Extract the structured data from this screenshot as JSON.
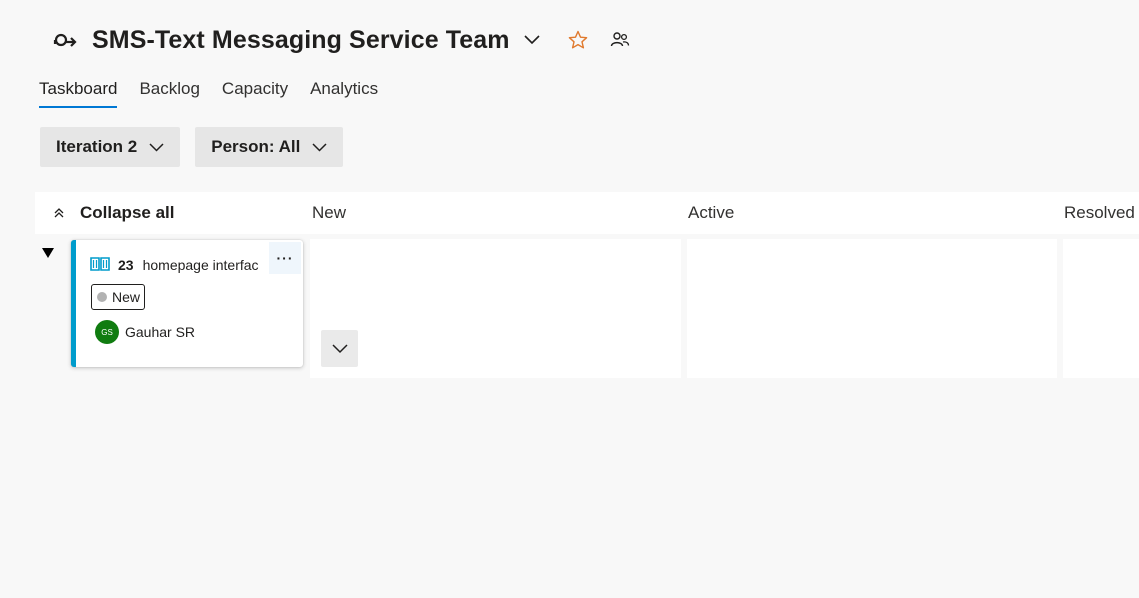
{
  "header": {
    "team_icon": "team-rotate-icon",
    "title": "SMS-Text Messaging Service Team",
    "accent_star": "#e07a2e"
  },
  "tabs": [
    {
      "label": "Taskboard",
      "selected": true
    },
    {
      "label": "Backlog",
      "selected": false
    },
    {
      "label": "Capacity",
      "selected": false
    },
    {
      "label": "Analytics",
      "selected": false
    }
  ],
  "filters": {
    "iteration": "Iteration 2",
    "person": "Person: All"
  },
  "board": {
    "collapse_all": "Collapse all",
    "columns": [
      "New",
      "Active",
      "Resolved"
    ]
  },
  "card": {
    "id": "23",
    "title": "homepage interfac",
    "state": "New",
    "state_color": "#b2b2b2",
    "accent_color": "#009ccc",
    "more_label": "···",
    "assignee_initials": "GS",
    "assignee_name": "Gauhar SR",
    "avatar_color": "#107c10"
  }
}
